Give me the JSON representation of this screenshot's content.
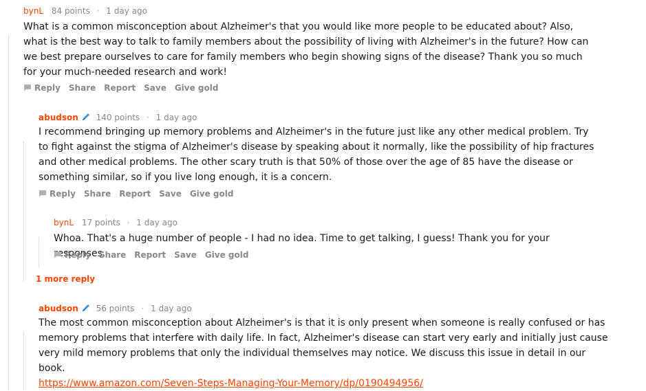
{
  "comments": [
    {
      "author": "bynL",
      "points": "84 points",
      "time": "1 day ago",
      "body": "What is a common misconception about Alzheimer's that you would like more people to be educated about? Also, what is the best way to talk to family members about the possibility of living with Alzheimer's in the future? How can we best prepare ourselves to care for family members who begin showing signs of the disease? Thank you so much for your much-needed research and work!"
    },
    {
      "author": "abudson",
      "points": "140 points",
      "time": "1 day ago",
      "body": "I recommend bringing up memory problems and Alzheimer's in the future just like any other medical problem. Try to fight against the stigma of Alzheimer's disease by speaking about it normally, like the possibility of hip fractures and other medical problems. The other scary truth is that 50% of those over the age of 85 have the disease or something similar, so if you live long enough, it is a concern."
    },
    {
      "author": "bynL",
      "points": "17 points",
      "time": "1 day ago",
      "body": "Whoa. That's a huge number of people - I had no idea. Time to get talking, I guess! Thank you for your responses."
    },
    {
      "author": "abudson",
      "points": "56 points",
      "time": "1 day ago",
      "body": "The most common misconception about Alzheimer's is that it is only present when someone is really confused or has memory problems that interfere with daily life. In fact, Alzheimer's disease can start very early and initially just cause very mild memory problems that only the individual themselves may notice. We discuss this issue in detail in our book.",
      "link": "https://www.amazon.com/Seven-Steps-Managing-Your-Memory/dp/0190494956/"
    }
  ],
  "actions": {
    "reply": "Reply",
    "share": "Share",
    "report": "Report",
    "save": "Save",
    "give_gold": "Give gold"
  },
  "more_reply": "1 more reply",
  "separator": "·",
  "colors": {
    "op_author": "#ff4500",
    "user_author": "#6a7fcf",
    "meta": "#888888",
    "arrow": "#878a8c"
  }
}
